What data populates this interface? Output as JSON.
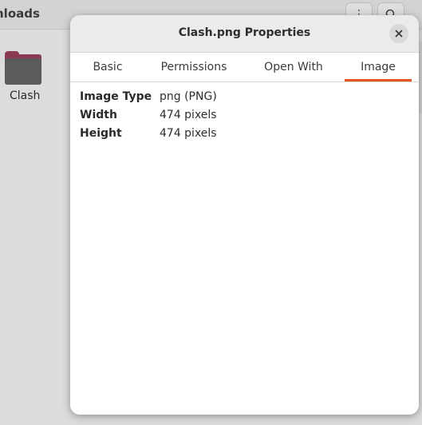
{
  "background": {
    "header_title": "nloads",
    "folder_label": "Clash"
  },
  "dialog": {
    "title": "Clash.png Properties",
    "tabs": [
      {
        "label": "Basic"
      },
      {
        "label": "Permissions"
      },
      {
        "label": "Open With"
      },
      {
        "label": "Image"
      }
    ],
    "active_tab": "Image",
    "rows": [
      {
        "label": "Image Type",
        "value": "png (PNG)"
      },
      {
        "label": "Width",
        "value": "474 pixels"
      },
      {
        "label": "Height",
        "value": "474 pixels"
      }
    ]
  },
  "colors": {
    "accent": "#e95420",
    "folder_accent": "#8a3b52"
  },
  "icons": {
    "menu": "kebab-menu-icon",
    "search": "search-icon",
    "close": "close-icon",
    "folder": "folder-icon"
  }
}
